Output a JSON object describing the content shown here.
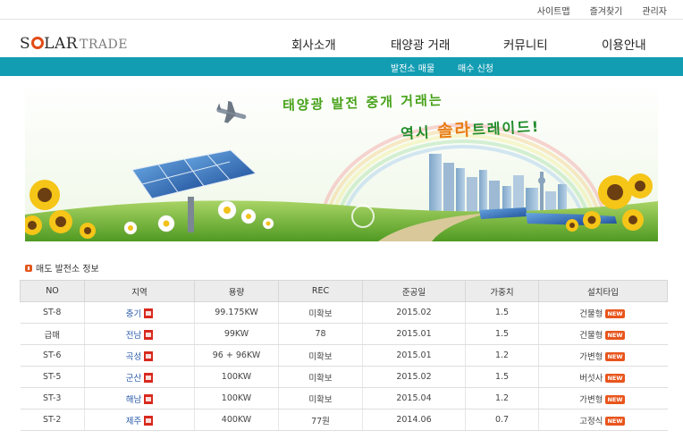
{
  "util_links": [
    "사이트맵",
    "즐겨찾기",
    "관리자"
  ],
  "logo": {
    "text_1": "S",
    "text_2": "LAR",
    "text_3": "TRADE"
  },
  "gnb": [
    "회사소개",
    "태양광 거래",
    "커뮤니티",
    "이용안내"
  ],
  "sub_nav": [
    "발전소 매물",
    "매수 신청"
  ],
  "banner": {
    "line1": "태양광 발전 중개 거래는",
    "line2_a": "역시 ",
    "line2_b": "솔라",
    "line2_c": "트레이드!"
  },
  "section_title": "매도 발전소 정보",
  "table": {
    "headers": [
      "NO",
      "지역",
      "용량",
      "REC",
      "준공일",
      "가중치",
      "설치타입"
    ],
    "rows": [
      {
        "no": "ST-8",
        "region": "충기",
        "capacity": "99.175KW",
        "rec": "미확보",
        "date": "2015.02",
        "weight": "1.5",
        "type": "건물형",
        "badge": "NEW"
      },
      {
        "no": "급매",
        "region": "전남",
        "capacity": "99KW",
        "rec": "78",
        "date": "2015.01",
        "weight": "1.5",
        "type": "건물형",
        "badge": "NEW"
      },
      {
        "no": "ST-6",
        "region": "곡성",
        "capacity": "96 + 96KW",
        "rec": "미확보",
        "date": "2015.01",
        "weight": "1.2",
        "type": "가변형",
        "badge": "NEW"
      },
      {
        "no": "ST-5",
        "region": "군산",
        "capacity": "100KW",
        "rec": "미확보",
        "date": "2015.02",
        "weight": "1.5",
        "type": "버섯사",
        "badge": "NEW"
      },
      {
        "no": "ST-3",
        "region": "해남",
        "capacity": "100KW",
        "rec": "미확보",
        "date": "2015.04",
        "weight": "1.2",
        "type": "가변형",
        "badge": "NEW"
      },
      {
        "no": "ST-2",
        "region": "제주",
        "capacity": "400KW",
        "rec": "77원",
        "date": "2014.06",
        "weight": "0.7",
        "type": "고정식",
        "badge": "NEW"
      }
    ]
  },
  "colors": {
    "accent": "#139db3",
    "badge": "#e8551c",
    "logo_sun": "#e24b17"
  },
  "icons": {
    "pdf": "pdf-icon",
    "bullet": "bullet-icon"
  }
}
